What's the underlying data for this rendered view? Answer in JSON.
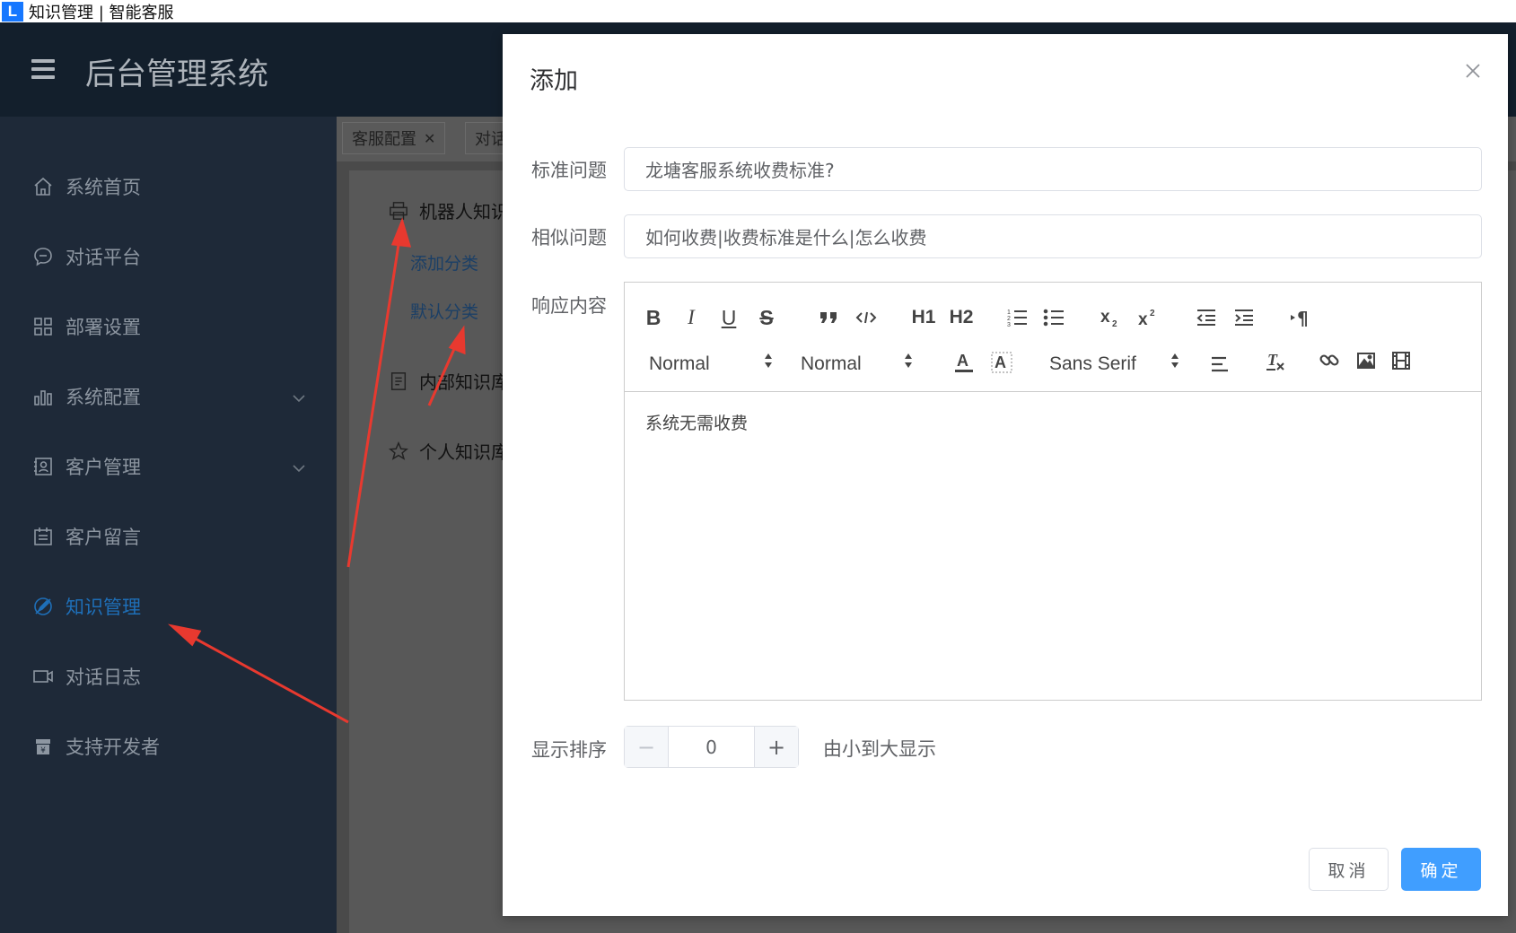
{
  "browser_tab": {
    "favicon_letter": "L",
    "title": "知识管理 | 智能客服"
  },
  "header": {
    "title": "后台管理系统"
  },
  "sidebar": {
    "items": [
      {
        "label": "系统首页",
        "icon": "home-icon"
      },
      {
        "label": "对话平台",
        "icon": "chat-icon"
      },
      {
        "label": "部署设置",
        "icon": "grid-icon"
      },
      {
        "label": "系统配置",
        "icon": "bar-chart-icon"
      },
      {
        "label": "客户管理",
        "icon": "contact-card-icon"
      },
      {
        "label": "客户留言",
        "icon": "calendar-icon"
      },
      {
        "label": "知识管理",
        "icon": "no-edit-icon"
      },
      {
        "label": "对话日志",
        "icon": "video-icon"
      },
      {
        "label": "支持开发者",
        "icon": "gift-icon"
      }
    ],
    "active": "知识管理"
  },
  "tags": [
    {
      "label": "客服配置"
    },
    {
      "label": "对话"
    }
  ],
  "tree": {
    "robot": "机器人知识",
    "add_category": "添加分类",
    "default_category": "默认分类",
    "internal": "内部知识库",
    "personal": "个人知识库"
  },
  "dialog": {
    "title": "添加",
    "fields": {
      "standard_label": "标准问题",
      "standard_value": "龙塘客服系统收费标准?",
      "similar_label": "相似问题",
      "similar_value": "如何收费|收费标准是什么|怎么收费",
      "response_label": "响应内容",
      "response_value": "系统无需收费",
      "order_label": "显示排序",
      "order_value": "0",
      "order_hint": "由小到大显示"
    },
    "toolbar": {
      "size_select": "Normal",
      "header_select": "Normal",
      "font_select": "Sans Serif",
      "bold": "B",
      "italic": "I",
      "underline": "U",
      "strike": "S",
      "h1": "H1",
      "h2": "H2"
    },
    "buttons": {
      "cancel": "取消",
      "ok": "确定"
    }
  },
  "colors": {
    "accent": "#409eff",
    "sidebar_bg": "#1e2938",
    "active_menu": "#1e6fb8",
    "arrow": "#e8392f"
  }
}
